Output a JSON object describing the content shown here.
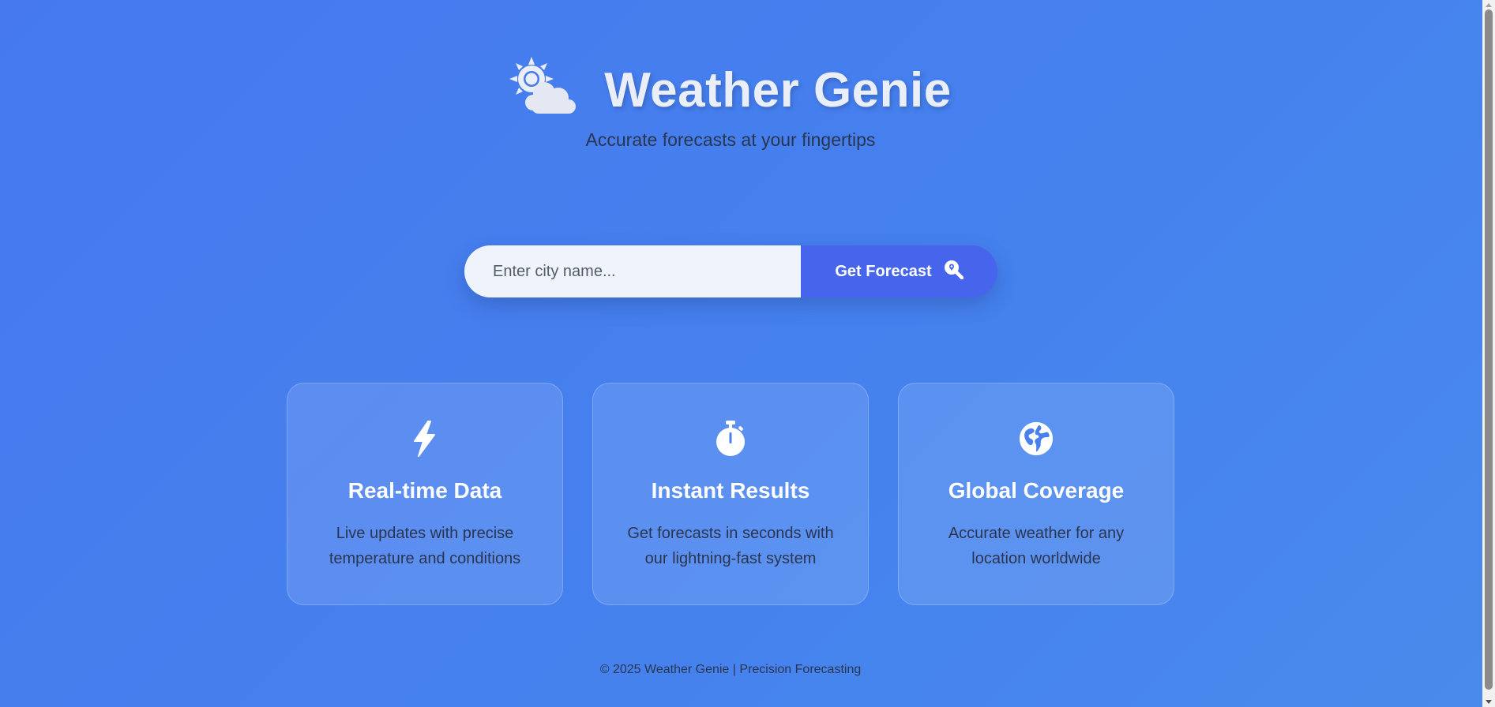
{
  "header": {
    "logo_icon": "sun-behind-cloud-icon",
    "title": "Weather Genie",
    "subtitle": "Accurate forecasts at your fingertips"
  },
  "search": {
    "placeholder": "Enter city name...",
    "value": "",
    "button_label": "Get Forecast",
    "button_icon": "search-location-icon"
  },
  "features": [
    {
      "icon": "lightning-bolt-icon",
      "title": "Real-time Data",
      "description": "Live updates with precise temperature and conditions"
    },
    {
      "icon": "stopwatch-icon",
      "title": "Instant Results",
      "description": "Get forecasts in seconds with our lightning-fast system"
    },
    {
      "icon": "globe-icon",
      "title": "Global Coverage",
      "description": "Accurate weather for any location worldwide"
    }
  ],
  "footer": {
    "text": "© 2025 Weather Genie | Precision Forecasting"
  },
  "colors": {
    "background": "#4679ef",
    "button": "#4765ec",
    "input_bg": "#eef3fc",
    "title": "#e9eef8",
    "body_text": "#2b3550"
  }
}
